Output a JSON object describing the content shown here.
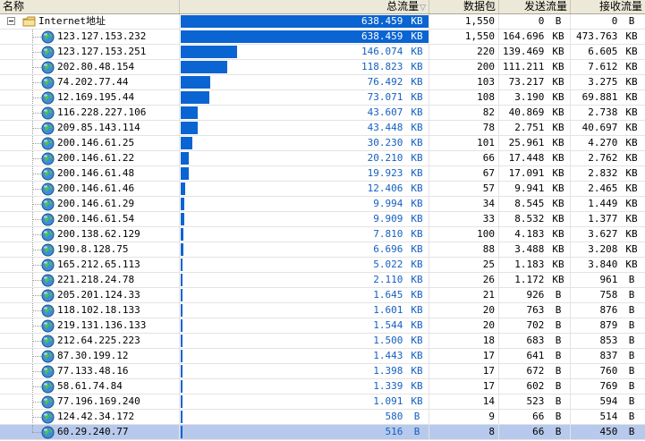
{
  "header": {
    "name": "名称",
    "total": "总流量",
    "packets": "数据包",
    "sent": "发送流量",
    "recv": "接收流量"
  },
  "root": {
    "label": "Internet地址",
    "total": "638.459 KB",
    "total_kb": 638.459,
    "packets": "1,550",
    "sent": "0 B",
    "recv": "0 B"
  },
  "max_total_kb": 638.459,
  "colors": {
    "bar": "#0a64d2",
    "total_text": "#1560c0",
    "selected_row": "#b7c9ec"
  },
  "rows": [
    {
      "ip": "123.127.153.232",
      "total": "638.459 KB",
      "total_kb": 638.459,
      "packets": "1,550",
      "sent": "164.696 KB",
      "recv": "473.763 KB"
    },
    {
      "ip": "123.127.153.251",
      "total": "146.074 KB",
      "total_kb": 146.074,
      "packets": "220",
      "sent": "139.469 KB",
      "recv": "6.605 KB"
    },
    {
      "ip": "202.80.48.154",
      "total": "118.823 KB",
      "total_kb": 118.823,
      "packets": "200",
      "sent": "111.211 KB",
      "recv": "7.612 KB"
    },
    {
      "ip": "74.202.77.44",
      "total": "76.492 KB",
      "total_kb": 76.492,
      "packets": "103",
      "sent": "73.217 KB",
      "recv": "3.275 KB"
    },
    {
      "ip": "12.169.195.44",
      "total": "73.071 KB",
      "total_kb": 73.071,
      "packets": "108",
      "sent": "3.190 KB",
      "recv": "69.881 KB"
    },
    {
      "ip": "116.228.227.106",
      "total": "43.607 KB",
      "total_kb": 43.607,
      "packets": "82",
      "sent": "40.869 KB",
      "recv": "2.738 KB"
    },
    {
      "ip": "209.85.143.114",
      "total": "43.448 KB",
      "total_kb": 43.448,
      "packets": "78",
      "sent": "2.751 KB",
      "recv": "40.697 KB"
    },
    {
      "ip": "200.146.61.25",
      "total": "30.230 KB",
      "total_kb": 30.23,
      "packets": "101",
      "sent": "25.961 KB",
      "recv": "4.270 KB"
    },
    {
      "ip": "200.146.61.22",
      "total": "20.210 KB",
      "total_kb": 20.21,
      "packets": "66",
      "sent": "17.448 KB",
      "recv": "2.762 KB"
    },
    {
      "ip": "200.146.61.48",
      "total": "19.923 KB",
      "total_kb": 19.923,
      "packets": "67",
      "sent": "17.091 KB",
      "recv": "2.832 KB"
    },
    {
      "ip": "200.146.61.46",
      "total": "12.406 KB",
      "total_kb": 12.406,
      "packets": "57",
      "sent": "9.941 KB",
      "recv": "2.465 KB"
    },
    {
      "ip": "200.146.61.29",
      "total": "9.994 KB",
      "total_kb": 9.994,
      "packets": "34",
      "sent": "8.545 KB",
      "recv": "1.449 KB"
    },
    {
      "ip": "200.146.61.54",
      "total": "9.909 KB",
      "total_kb": 9.909,
      "packets": "33",
      "sent": "8.532 KB",
      "recv": "1.377 KB"
    },
    {
      "ip": "200.138.62.129",
      "total": "7.810 KB",
      "total_kb": 7.81,
      "packets": "100",
      "sent": "4.183 KB",
      "recv": "3.627 KB"
    },
    {
      "ip": "190.8.128.75",
      "total": "6.696 KB",
      "total_kb": 6.696,
      "packets": "88",
      "sent": "3.488 KB",
      "recv": "3.208 KB"
    },
    {
      "ip": "165.212.65.113",
      "total": "5.022 KB",
      "total_kb": 5.022,
      "packets": "25",
      "sent": "1.183 KB",
      "recv": "3.840 KB"
    },
    {
      "ip": "221.218.24.78",
      "total": "2.110 KB",
      "total_kb": 2.11,
      "packets": "26",
      "sent": "1.172 KB",
      "recv": "961 B"
    },
    {
      "ip": "205.201.124.33",
      "total": "1.645 KB",
      "total_kb": 1.645,
      "packets": "21",
      "sent": "926 B",
      "recv": "758 B"
    },
    {
      "ip": "118.102.18.133",
      "total": "1.601 KB",
      "total_kb": 1.601,
      "packets": "20",
      "sent": "763 B",
      "recv": "876 B"
    },
    {
      "ip": "219.131.136.133",
      "total": "1.544 KB",
      "total_kb": 1.544,
      "packets": "20",
      "sent": "702 B",
      "recv": "879 B"
    },
    {
      "ip": "212.64.225.223",
      "total": "1.500 KB",
      "total_kb": 1.5,
      "packets": "18",
      "sent": "683 B",
      "recv": "853 B"
    },
    {
      "ip": "87.30.199.12",
      "total": "1.443 KB",
      "total_kb": 1.443,
      "packets": "17",
      "sent": "641 B",
      "recv": "837 B"
    },
    {
      "ip": "77.133.48.16",
      "total": "1.398 KB",
      "total_kb": 1.398,
      "packets": "17",
      "sent": "672 B",
      "recv": "760 B"
    },
    {
      "ip": "58.61.74.84",
      "total": "1.339 KB",
      "total_kb": 1.339,
      "packets": "17",
      "sent": "602 B",
      "recv": "769 B"
    },
    {
      "ip": "77.196.169.240",
      "total": "1.091 KB",
      "total_kb": 1.091,
      "packets": "14",
      "sent": "523 B",
      "recv": "594 B"
    },
    {
      "ip": "124.42.34.172",
      "total": "580 B",
      "total_kb": 0.58,
      "packets": "9",
      "sent": "66 B",
      "recv": "514 B"
    },
    {
      "ip": "60.29.240.77",
      "total": "516 B",
      "total_kb": 0.516,
      "packets": "8",
      "sent": "66 B",
      "recv": "450 B",
      "selected": true
    }
  ]
}
